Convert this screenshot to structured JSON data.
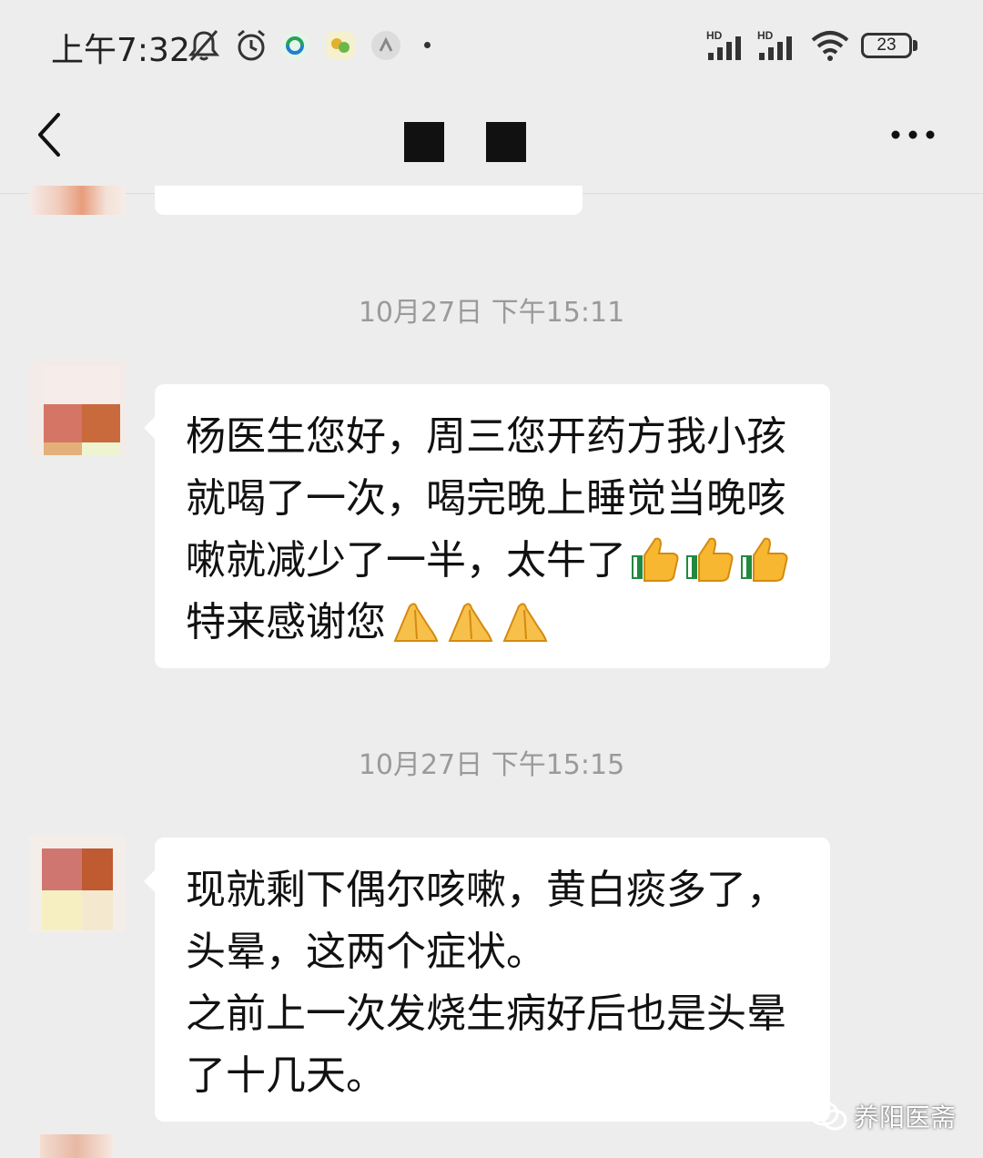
{
  "status_bar": {
    "time": "上午7:32",
    "battery": "23",
    "signal_1_label": "HD",
    "signal_2_label": "HD",
    "icons": [
      "mute-bell-icon",
      "alarm-clock-icon",
      "app-notification-icon",
      "app-notification-icon",
      "app-notification-icon",
      "wifi-icon",
      "battery-icon"
    ]
  },
  "header": {
    "back_icon": "chevron-left-icon",
    "title_redacted": true,
    "more_icon": "more-dots-icon"
  },
  "messages": [
    {
      "timestamp": "10月27日 下午15:11",
      "lines": [
        "杨医生您好，周三您开药方我小孩",
        "就喝了一次，喝完晚上睡觉当晚咳",
        "嗽就减少了一半，太牛了",
        "特来感谢您"
      ],
      "line3_emoji": "thumbs-up-icon",
      "line3_emoji_count": 3,
      "line4_emoji": "praying-hands-icon",
      "line4_emoji_count": 3
    },
    {
      "timestamp": "10月27日 下午15:15",
      "lines": [
        "现就剩下偶尔咳嗽，黄白痰多了，",
        "头晕，这两个症状。",
        "之前上一次发烧生病好后也是头晕",
        "了十几天。"
      ]
    }
  ],
  "watermark": {
    "text": "养阳医斋",
    "icon": "wechat-logo-icon"
  },
  "colors": {
    "background": "#ededed",
    "bubble": "#ffffff",
    "timestamp_text": "#9a9a9a",
    "text": "#111111"
  }
}
